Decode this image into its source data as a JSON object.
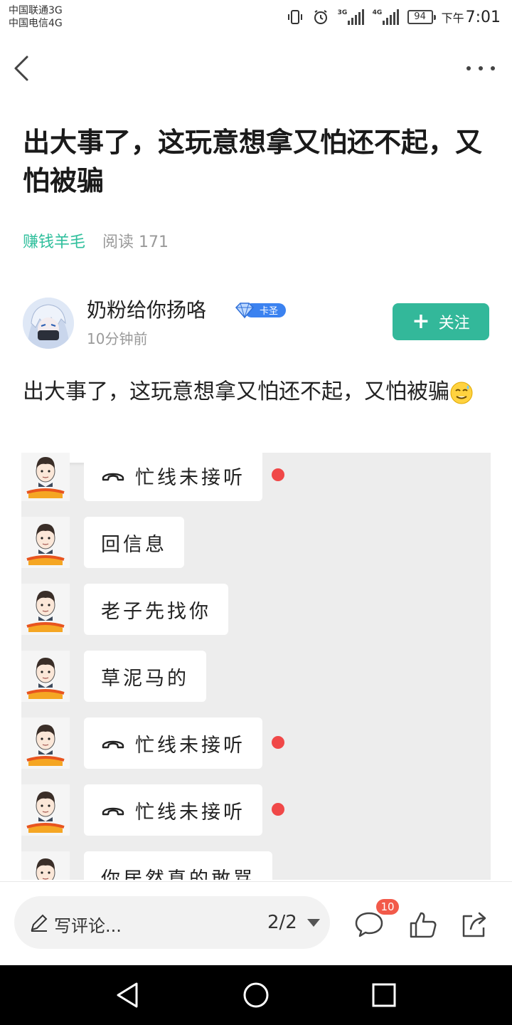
{
  "status_bar": {
    "carrier_1": "中国联通3G",
    "carrier_2": "中国电信4G",
    "net_1": "3G",
    "net_2": "4G",
    "battery": "94",
    "time_ampm": "下午",
    "time": "7:01"
  },
  "nav": {
    "back_icon": "chevron-left-icon",
    "more_icon": "more-horizontal-icon"
  },
  "post": {
    "title": "出大事了，这玩意想拿又怕还不起，又怕被骗",
    "category": "赚钱羊毛",
    "reads_label": "阅读 171",
    "author": {
      "name": "奶粉给你扬咯",
      "badge": "卡圣",
      "time": "10分钟前",
      "follow_label": "关注"
    },
    "body_text": "出大事了，这玩意想拿又怕还不起，又怕被骗"
  },
  "chat": {
    "messages": [
      {
        "text": "忙线未接听",
        "call": true
      },
      {
        "text": "回信息",
        "call": false
      },
      {
        "text": "老子先找你",
        "call": false
      },
      {
        "text": "草泥马的",
        "call": false
      },
      {
        "text": "忙线未接听",
        "call": true
      },
      {
        "text": "忙线未接听",
        "call": true
      },
      {
        "text": "你居然真的敢骂",
        "call": false
      }
    ]
  },
  "bottom_bar": {
    "comment_placeholder": "写评论...",
    "page_indicator": "2/2",
    "comment_count": "10"
  },
  "colors": {
    "accent": "#33b89a",
    "category": "#2fbf9c",
    "badge_red": "#f25a4a",
    "missed_dot": "#f04848"
  }
}
